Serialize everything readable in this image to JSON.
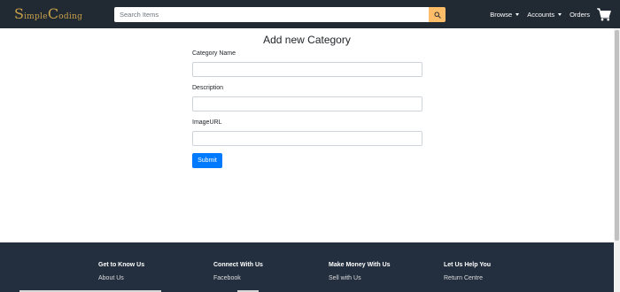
{
  "header": {
    "brand": {
      "letters": [
        {
          "text": "S",
          "cap": true
        },
        {
          "text": "imple",
          "cap": false
        },
        {
          "text": "C",
          "cap": true
        },
        {
          "text": "oding",
          "cap": false
        }
      ]
    },
    "search": {
      "placeholder": "Search Items",
      "value": "",
      "button_icon": "search-icon"
    },
    "nav": {
      "browse": "Browse",
      "accounts": "Accounts",
      "orders": "Orders",
      "cart_icon": "shopping-cart-icon"
    }
  },
  "form": {
    "title": "Add new Category",
    "fields": [
      {
        "label": "Category Name",
        "value": ""
      },
      {
        "label": "Description",
        "value": ""
      },
      {
        "label": "ImageURL",
        "value": ""
      }
    ],
    "submit_label": "Submit"
  },
  "footer": {
    "columns": [
      {
        "heading": "Get to Know Us",
        "link": "About Us"
      },
      {
        "heading": "Connect With Us",
        "link": "Facebook"
      },
      {
        "heading": "Make Money With Us",
        "link": "Sell with Us"
      },
      {
        "heading": "Let Us Help You",
        "link": "Return Centre"
      }
    ]
  },
  "colors": {
    "navbar_bg": "#212a33",
    "brand_gold": "#c8a04a",
    "search_button": "#febd69",
    "submit_button": "#007bff",
    "footer_bg": "#232f3e"
  }
}
